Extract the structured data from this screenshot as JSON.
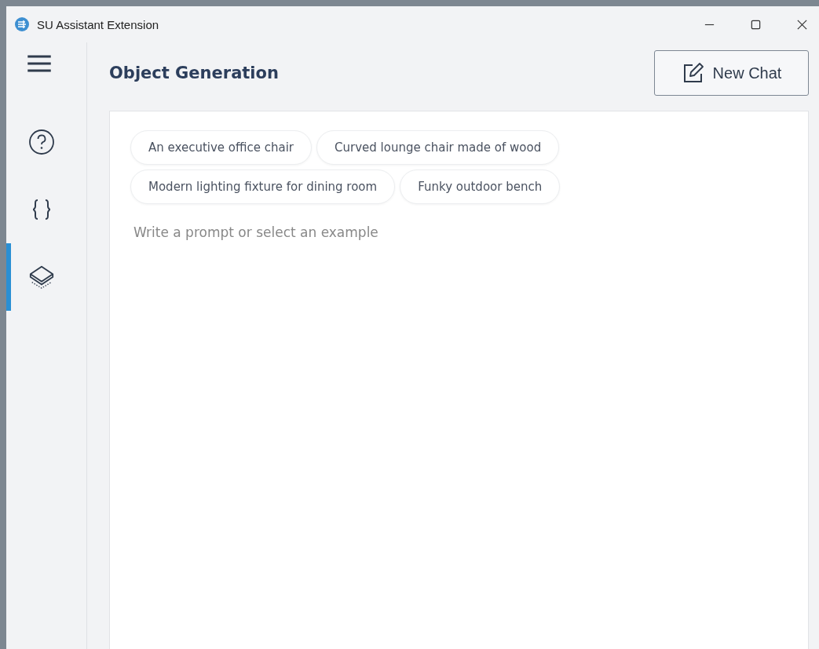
{
  "window": {
    "title": "SU Assistant Extension"
  },
  "sidebar": {
    "items": [
      {
        "kind": "help",
        "selected": false
      },
      {
        "kind": "code",
        "selected": false
      },
      {
        "kind": "layers",
        "selected": true
      }
    ]
  },
  "header": {
    "title": "Object Generation",
    "button": "New Chat"
  },
  "examples": [
    [
      "An executive office chair",
      "Curved lounge chair made of wood"
    ],
    [
      "Modern lighting fixture for dining room",
      "Funky outdoor bench"
    ]
  ],
  "prompt": {
    "placeholder": "Write a prompt or select an example"
  }
}
